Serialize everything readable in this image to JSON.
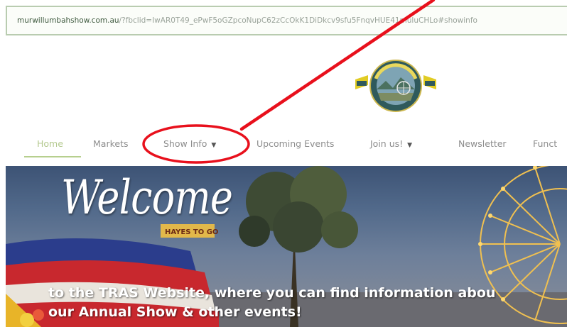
{
  "browser": {
    "url_domain": "murwillumbahshow.com.au",
    "url_rest": "/?fbclid=IwAR0T49_ePwF5oGZpcoNupC62zCcOkK1DiDkcv9sfu5FnqvHUE41muluCHLo#showinfo"
  },
  "logo": {
    "label": "TWEED RIVER logo"
  },
  "nav": {
    "items": [
      {
        "label": "Home",
        "active": true
      },
      {
        "label": "Markets"
      },
      {
        "label": "Show Info",
        "dropdown": true
      },
      {
        "label": "Upcoming Events"
      },
      {
        "label": "Join us!",
        "dropdown": true
      },
      {
        "label": "Newsletter"
      },
      {
        "label": "Funct"
      }
    ],
    "caret_icon": "caret-down-icon"
  },
  "hero": {
    "title": "Welcome",
    "sign_text": "HAYES TO GO",
    "tagline_line1": "to the TRAS Website, where you can find information abou",
    "tagline_line2": "our Annual Show & other events!"
  },
  "annotation": {
    "color": "#e8101c",
    "shape": "ellipse-with-arrow",
    "target": "Show Info"
  }
}
